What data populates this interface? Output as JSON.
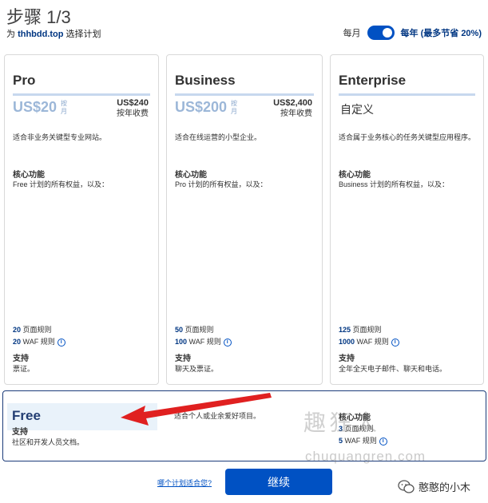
{
  "header": {
    "title": "步骤 1/3",
    "sub_prefix": "为",
    "domain": "thhbdd.top",
    "sub_suffix": "选择计划"
  },
  "billing": {
    "monthly_label": "每月",
    "yearly_label": "每年",
    "yearly_discount": "(最多节省 20%)",
    "selected": "yearly"
  },
  "plans": {
    "pro": {
      "name": "Pro",
      "price": "US$20",
      "unit": "按月",
      "annual_price": "US$240",
      "annual_label": "按年收费",
      "description": "适合非业务关键型专业网站。",
      "features_title": "核心功能",
      "features_sub": "Free 计划的所有权益，以及：",
      "page_rules_count": "20",
      "page_rules_label": "页面规则",
      "waf_count": "20",
      "waf_label": "WAF 规则",
      "support_title": "支持",
      "support_text": "票证。"
    },
    "business": {
      "name": "Business",
      "price": "US$200",
      "unit": "按月",
      "annual_price": "US$2,400",
      "annual_label": "按年收费",
      "description": "适合在线运营的小型企业。",
      "features_title": "核心功能",
      "features_sub": "Pro 计划的所有权益，以及：",
      "page_rules_count": "50",
      "page_rules_label": "页面规则",
      "waf_count": "100",
      "waf_label": "WAF 规则",
      "support_title": "支持",
      "support_text": "聊天及票证。"
    },
    "enterprise": {
      "name": "Enterprise",
      "price": "自定义",
      "description": "适合属于业务核心的任务关键型应用程序。",
      "features_title": "核心功能",
      "features_sub": "Business 计划的所有权益，以及：",
      "page_rules_count": "125",
      "page_rules_label": "页面规则",
      "waf_count": "1000",
      "waf_label": "WAF 规则",
      "support_title": "支持",
      "support_text": "全年全天电子邮件、聊天和电话。"
    },
    "free": {
      "name": "Free",
      "support_title": "支持",
      "support_text": "社区和开发人员文档。",
      "description": "适合个人或业余爱好项目。",
      "features_title": "核心功能",
      "page_rules_count": "3",
      "page_rules_label": "页面规则",
      "waf_count": "5",
      "waf_label": "WAF 规则"
    }
  },
  "footer": {
    "help_link": "哪个计划适合您?",
    "continue_label": "继续"
  },
  "watermark": {
    "text": "趣狂人",
    "url": "chuquangren.com",
    "brand": "憨憨的小木"
  },
  "colors": {
    "accent": "#0051c3",
    "dark_blue": "#003682",
    "arrow_red": "#e02020",
    "free_border": "#1c3c7a"
  },
  "icons": {
    "info": "info-circle-icon",
    "arrow": "red-arrow-annotation",
    "brand": "wechat-icon"
  }
}
